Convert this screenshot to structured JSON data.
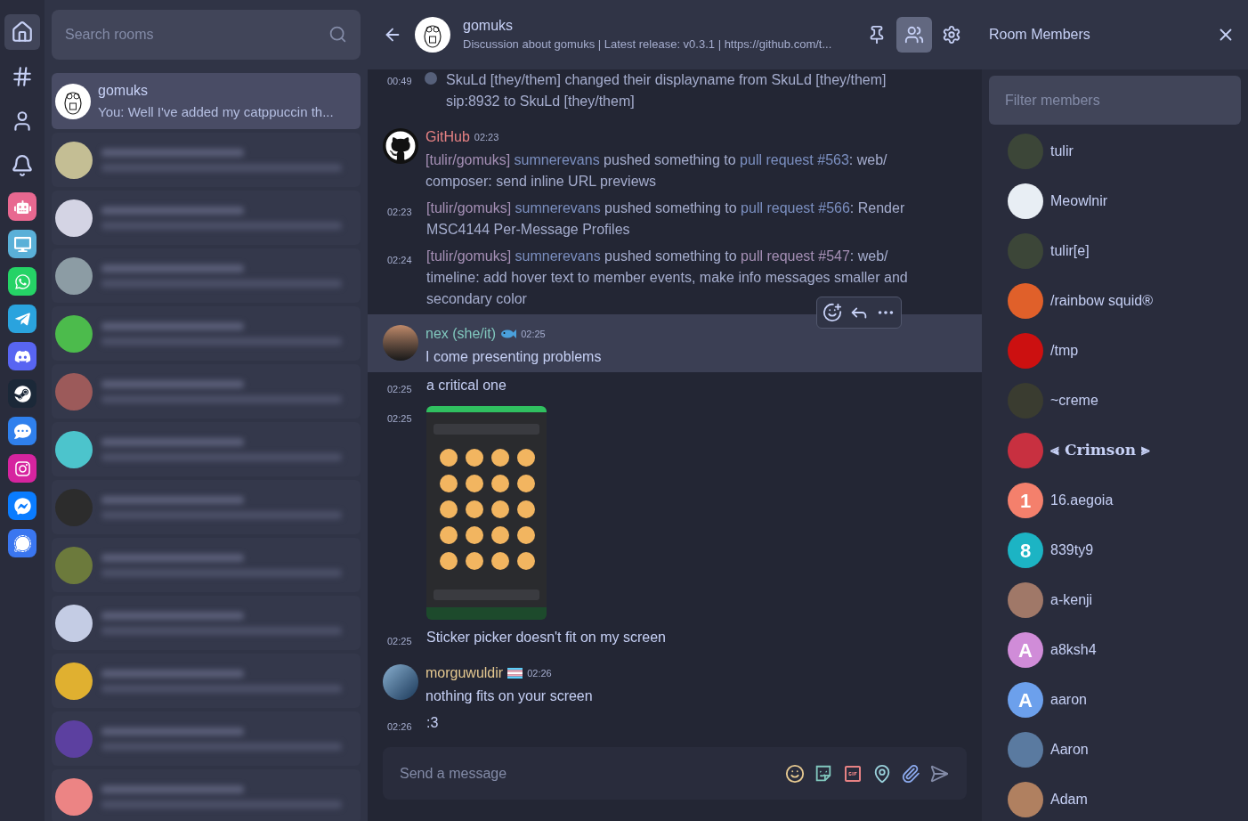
{
  "rail": [
    {
      "kind": "nav",
      "selected": true
    },
    {
      "kind": "nav",
      "selected": false
    },
    {
      "kind": "nav",
      "selected": false
    },
    {
      "kind": "nav",
      "selected": false
    },
    {
      "kind": "app",
      "selected": false,
      "color": "#e86890"
    },
    {
      "kind": "app",
      "selected": false,
      "color": "#5ab0d8"
    },
    {
      "kind": "app",
      "selected": false,
      "color": "#25d366"
    },
    {
      "kind": "app",
      "selected": false,
      "color": "#2aa3de"
    },
    {
      "kind": "app",
      "selected": false,
      "color": "#5865f2"
    },
    {
      "kind": "app",
      "selected": false,
      "color": "#1b2838"
    },
    {
      "kind": "app",
      "selected": false,
      "color": "#2f80ed"
    },
    {
      "kind": "app",
      "selected": false,
      "color": "#d6249f"
    },
    {
      "kind": "app",
      "selected": false,
      "color": "#0a7cff"
    },
    {
      "kind": "app",
      "selected": false,
      "color": "#3a76f0"
    }
  ],
  "room_search": {
    "placeholder": "Search rooms"
  },
  "rooms": [
    {
      "kind": "room",
      "name": "gomuks",
      "preview": "You: Well I've added my catppuccin th...",
      "selected": true
    },
    {
      "kind": "blurred",
      "color": "#c4be94",
      "selected": false
    },
    {
      "kind": "blurred",
      "color": "#d4d4e4",
      "selected": false
    },
    {
      "kind": "blurred",
      "color": "#8c9ca4",
      "selected": false
    },
    {
      "kind": "blurred",
      "color": "#4cbb4c",
      "selected": false
    },
    {
      "kind": "blurred",
      "color": "#9c5a5a",
      "selected": false
    },
    {
      "kind": "blurred",
      "color": "#4cc4cc",
      "selected": false
    },
    {
      "kind": "blurred",
      "color": "#2c2c2c",
      "selected": false
    },
    {
      "kind": "blurred",
      "color": "#6c7a3c",
      "selected": false
    },
    {
      "kind": "blurred",
      "color": "#c4cce4",
      "selected": false
    },
    {
      "kind": "blurred",
      "color": "#e0b030",
      "selected": false
    },
    {
      "kind": "blurred",
      "color": "#5c40a0",
      "selected": false
    },
    {
      "kind": "blurred",
      "color": "#ec8484",
      "selected": false
    }
  ],
  "room_header": {
    "name": "gomuks",
    "topic": "Discussion about gomuks | Latest release: v0.3.1 | https://github.com/t...",
    "actions": [
      {
        "selected": false
      },
      {
        "selected": true
      },
      {
        "selected": false
      }
    ]
  },
  "timeline": [
    {
      "kind": "event",
      "time": "00:49",
      "text": "SkuLd [they/them] changed their displayname from SkuLd [they/them] sip:8932 to SkuLd [they/them]"
    },
    {
      "kind": "group",
      "sender": "GitHub",
      "color": "#e78284",
      "time": "02:23",
      "hovered": false,
      "messages": [
        {
          "kind": "rich",
          "segments": [
            {
              "kind": "repo",
              "text": "[tulir/gomuks]"
            },
            {
              "kind": "user",
              "text": "sumnerevans"
            },
            {
              "kind": "plain",
              "text": " pushed something to "
            },
            {
              "kind": "link",
              "text": "pull request #563"
            },
            {
              "kind": "plain",
              "text": ": web/ composer: send inline URL previews"
            }
          ]
        },
        {
          "time": "02:23",
          "kind": "rich",
          "segments": [
            {
              "kind": "repo",
              "text": "[tulir/gomuks]"
            },
            {
              "kind": "user",
              "text": "sumnerevans"
            },
            {
              "kind": "plain",
              "text": " pushed something to "
            },
            {
              "kind": "link",
              "text": "pull request #566"
            },
            {
              "kind": "plain",
              "text": ": Render MSC4144 Per-Message Profiles"
            }
          ]
        },
        {
          "time": "02:24",
          "kind": "rich",
          "segments": [
            {
              "kind": "repo",
              "text": "[tulir/gomuks]"
            },
            {
              "kind": "user",
              "text": "sumnerevans"
            },
            {
              "kind": "plain",
              "text": " pushed something to "
            },
            {
              "kind": "visited",
              "text": "pull request #547"
            },
            {
              "kind": "plain",
              "text": ": web/ timeline: add hover text to member events, make info messages smaller and secondary color"
            }
          ]
        }
      ]
    },
    {
      "kind": "group",
      "sender": "nex (she/it)",
      "color": "#81c8be",
      "time": "02:25",
      "hovered": true,
      "messages": [
        {
          "kind": "text",
          "text": "I come presenting problems"
        }
      ]
    },
    {
      "kind": "continuation",
      "messages": [
        {
          "time": "02:25",
          "kind": "text",
          "text": "a critical one"
        },
        {
          "time": "02:25",
          "kind": "image"
        },
        {
          "time": "02:25",
          "kind": "text",
          "text": "Sticker picker doesn't fit on my screen"
        }
      ]
    },
    {
      "kind": "group",
      "sender": "morguwuldir",
      "color": "#e5c890",
      "time": "02:26",
      "hovered": false,
      "messages": [
        {
          "kind": "text",
          "text": "nothing fits on your screen"
        },
        {
          "time": "02:26",
          "kind": "text",
          "text": ":3"
        }
      ]
    }
  ],
  "composer": {
    "placeholder": "Send a message"
  },
  "members_panel": {
    "title": "Room Members",
    "filter": {
      "placeholder": "Filter members"
    },
    "members": [
      {
        "name": "tulir",
        "fancy": false,
        "avatar": {
          "kind": "photo",
          "color": "#3c4638"
        }
      },
      {
        "name": "Meowlnir",
        "fancy": false,
        "avatar": {
          "kind": "photo",
          "color": "#e8eef4"
        }
      },
      {
        "name": "tulir[e]",
        "fancy": false,
        "avatar": {
          "kind": "photo",
          "color": "#3c4638"
        }
      },
      {
        "name": "/rainbow squid®",
        "fancy": false,
        "avatar": {
          "kind": "photo",
          "color": "#e0602a"
        }
      },
      {
        "name": "/tmp",
        "fancy": false,
        "avatar": {
          "kind": "photo",
          "color": "#cc1010"
        }
      },
      {
        "name": "~creme",
        "fancy": false,
        "avatar": {
          "kind": "photo",
          "color": "#3a3c30"
        }
      },
      {
        "name": "⫷ Crimson ⫸",
        "fancy": true,
        "avatar": {
          "kind": "photo",
          "color": "#c83040"
        }
      },
      {
        "name": "16.aegoia",
        "fancy": false,
        "avatar": {
          "kind": "letter",
          "letter": "1",
          "color": "#f4806c"
        }
      },
      {
        "name": "839ty9",
        "fancy": false,
        "avatar": {
          "kind": "letter",
          "letter": "8",
          "color": "#1cb4c4"
        }
      },
      {
        "name": "a-kenji",
        "fancy": false,
        "avatar": {
          "kind": "photo",
          "color": "#a07868"
        }
      },
      {
        "name": "a8ksh4",
        "fancy": false,
        "avatar": {
          "kind": "letter",
          "letter": "A",
          "color": "#d08cd8"
        }
      },
      {
        "name": "aaron",
        "fancy": false,
        "avatar": {
          "kind": "letter",
          "letter": "A",
          "color": "#6ca0ec"
        }
      },
      {
        "name": "Aaron",
        "fancy": false,
        "avatar": {
          "kind": "photo",
          "color": "#5a7aa0"
        }
      },
      {
        "name": "Adam",
        "fancy": false,
        "avatar": {
          "kind": "photo",
          "color": "#b08060"
        }
      }
    ]
  }
}
